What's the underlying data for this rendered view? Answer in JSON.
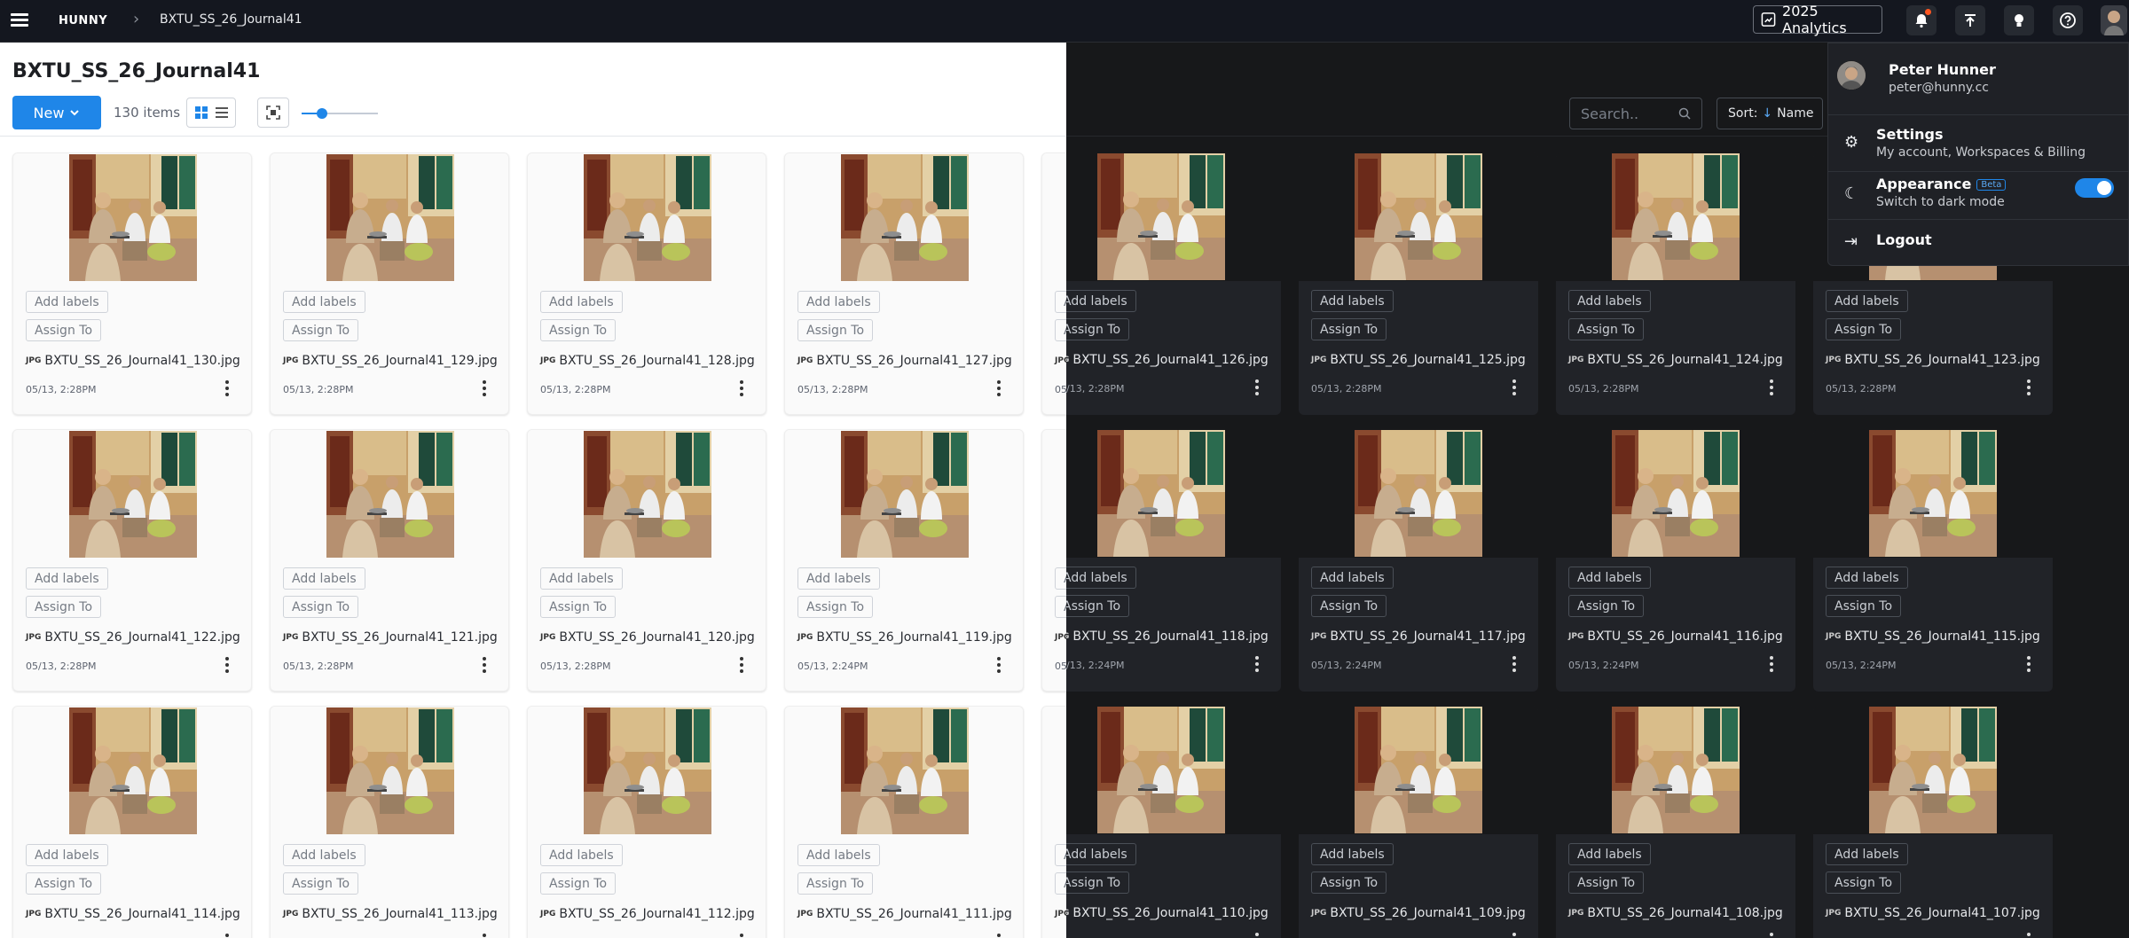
{
  "app": {
    "logo": "HUNNY",
    "breadcrumb": "BXTU_SS_26_Journal41",
    "analytics_label": "2025 Analytics"
  },
  "icons": {
    "menu": "menu-icon",
    "analytics": "chart-icon",
    "notifications": "bell-icon",
    "upload": "upload-icon",
    "ideas": "lightbulb-icon",
    "help": "help-icon",
    "search": "search-icon",
    "sort_arrow": "arrow-down-icon",
    "grid_view": "grid-icon",
    "list_view": "list-icon",
    "expand": "expand-icon",
    "settings": "gear-icon",
    "appearance": "moon-icon",
    "logout": "logout-icon",
    "more": "kebab-icon"
  },
  "colors": {
    "accent": "#1f86e8",
    "topbar": "#14171f",
    "dark_bg": "#17181a",
    "notification_dot": "#ff5722"
  },
  "folder": {
    "title": "BXTU_SS_26_Journal41",
    "new_label": "New",
    "item_count": "130 items",
    "thumbnail_size": 0.2
  },
  "toolbar": {
    "search_placeholder": "Search..",
    "sort_prefix": "Sort:",
    "sort_value": "Name"
  },
  "labels": {
    "add_labels": "Add labels",
    "assign_to": "Assign To",
    "file_type_badge": "JPG"
  },
  "user_menu": {
    "name": "Peter Hunner",
    "email": "peter@hunny.cc",
    "settings_title": "Settings",
    "settings_sub": "My account, Workspaces & Billing",
    "appearance_title": "Appearance",
    "appearance_badge": "Beta",
    "appearance_sub": "Switch to dark mode",
    "appearance_on": true,
    "logout": "Logout"
  },
  "files": [
    {
      "name": "BXTU_SS_26_Journal41_130.jpg",
      "date": "05/13, 2:28PM"
    },
    {
      "name": "BXTU_SS_26_Journal41_129.jpg",
      "date": "05/13, 2:28PM"
    },
    {
      "name": "BXTU_SS_26_Journal41_128.jpg",
      "date": "05/13, 2:28PM"
    },
    {
      "name": "BXTU_SS_26_Journal41_127.jpg",
      "date": "05/13, 2:28PM"
    },
    {
      "name": "BXTU_SS_26_Journal41_126.jpg",
      "date": "05/13, 2:28PM"
    },
    {
      "name": "BXTU_SS_26_Journal41_125.jpg",
      "date": "05/13, 2:28PM"
    },
    {
      "name": "BXTU_SS_26_Journal41_124.jpg",
      "date": "05/13, 2:28PM"
    },
    {
      "name": "BXTU_SS_26_Journal41_123.jpg",
      "date": "05/13, 2:28PM"
    },
    {
      "name": "BXTU_SS_26_Journal41_122.jpg",
      "date": "05/13, 2:28PM"
    },
    {
      "name": "BXTU_SS_26_Journal41_121.jpg",
      "date": "05/13, 2:28PM"
    },
    {
      "name": "BXTU_SS_26_Journal41_120.jpg",
      "date": "05/13, 2:28PM"
    },
    {
      "name": "BXTU_SS_26_Journal41_119.jpg",
      "date": "05/13, 2:24PM"
    },
    {
      "name": "BXTU_SS_26_Journal41_118.jpg",
      "date": "05/13, 2:24PM"
    },
    {
      "name": "BXTU_SS_26_Journal41_117.jpg",
      "date": "05/13, 2:24PM"
    },
    {
      "name": "BXTU_SS_26_Journal41_116.jpg",
      "date": "05/13, 2:24PM"
    },
    {
      "name": "BXTU_SS_26_Journal41_115.jpg",
      "date": "05/13, 2:24PM"
    },
    {
      "name": "BXTU_SS_26_Journal41_114.jpg",
      "date": ""
    },
    {
      "name": "BXTU_SS_26_Journal41_113.jpg",
      "date": ""
    },
    {
      "name": "BXTU_SS_26_Journal41_112.jpg",
      "date": ""
    },
    {
      "name": "BXTU_SS_26_Journal41_111.jpg",
      "date": ""
    },
    {
      "name": "BXTU_SS_26_Journal41_110.jpg",
      "date": ""
    },
    {
      "name": "BXTU_SS_26_Journal41_109.jpg",
      "date": ""
    },
    {
      "name": "BXTU_SS_26_Journal41_108.jpg",
      "date": ""
    },
    {
      "name": "BXTU_SS_26_Journal41_107.jpg",
      "date": ""
    }
  ]
}
